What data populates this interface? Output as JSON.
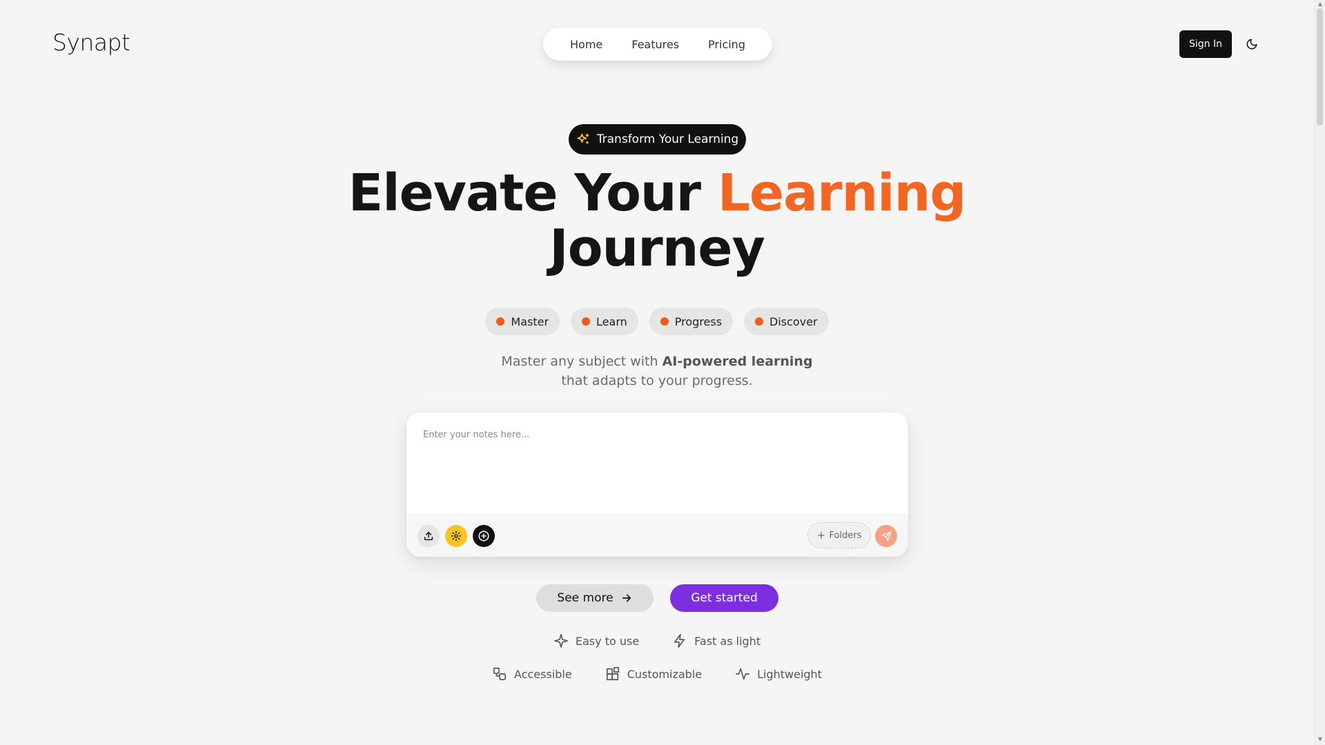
{
  "header": {
    "logo": "Synapt",
    "nav": [
      "Home",
      "Features",
      "Pricing"
    ],
    "sign_in": "Sign In"
  },
  "hero": {
    "badge": "Transform Your Learning",
    "headline_part1": "Elevate Your ",
    "headline_accent": "Learning",
    "headline_part2": "Journey",
    "chips": [
      "Master",
      "Learn",
      "Progress",
      "Discover"
    ],
    "subtitle_before": "Master any subject with ",
    "subtitle_bold": "AI-powered learning",
    "subtitle_after": "that adapts to your progress."
  },
  "notes": {
    "placeholder": "Enter your notes here...",
    "folders_label": "Folders"
  },
  "cta": {
    "see_more": "See more",
    "get_started": "Get started"
  },
  "features": {
    "row1": [
      {
        "label": "Easy to use",
        "icon": "sparkle-icon"
      },
      {
        "label": "Fast as light",
        "icon": "lightning-icon"
      }
    ],
    "row2": [
      {
        "label": "Accessible",
        "icon": "shapes-icon"
      },
      {
        "label": "Customizable",
        "icon": "blocks-icon"
      },
      {
        "label": "Lightweight",
        "icon": "activity-icon"
      }
    ]
  },
  "colors": {
    "accent_orange": "#f26522",
    "primary_purple": "#7c2ee0",
    "settings_yellow": "#f7c325",
    "send_peach": "#f5a284"
  }
}
